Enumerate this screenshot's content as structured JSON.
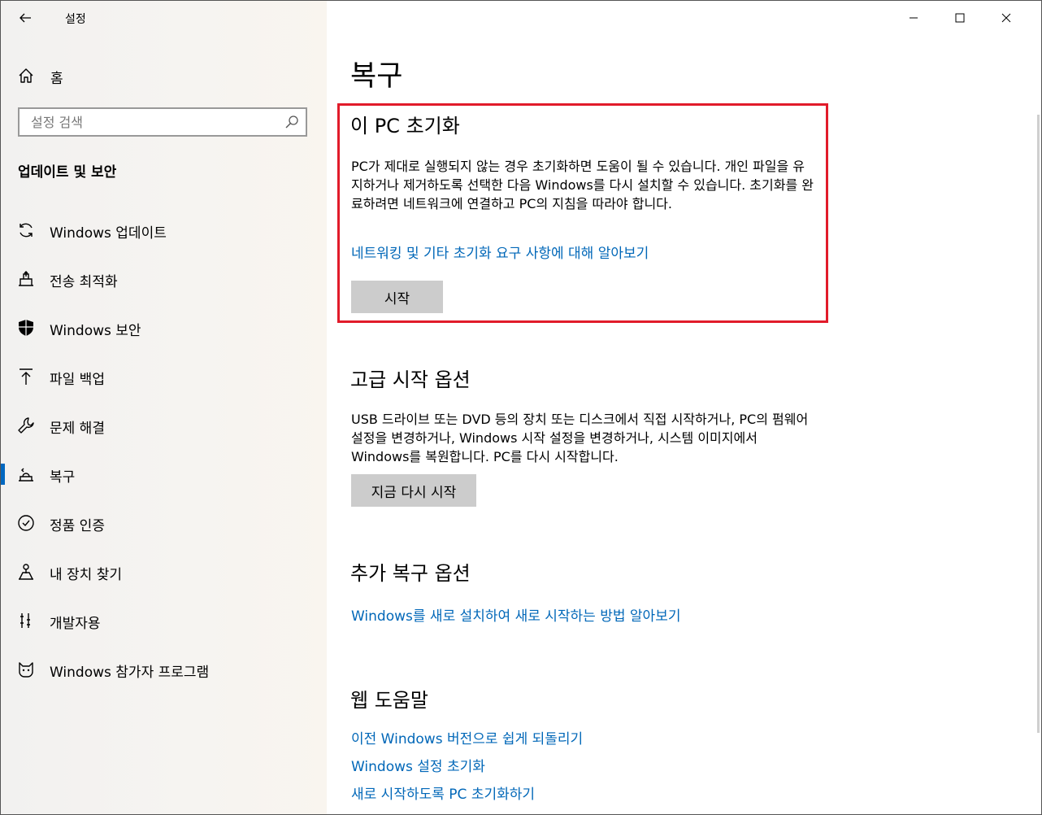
{
  "window": {
    "app_title": "설정"
  },
  "sidebar": {
    "home_label": "홈",
    "search_placeholder": "설정 검색",
    "section_title": "업데이트 및 보안",
    "items": [
      {
        "label": "Windows 업데이트",
        "icon": "sync-icon",
        "selected": false
      },
      {
        "label": "전송 최적화",
        "icon": "delivery-optimization-icon",
        "selected": false
      },
      {
        "label": "Windows 보안",
        "icon": "shield-icon",
        "selected": false
      },
      {
        "label": "파일 백업",
        "icon": "backup-arrow-icon",
        "selected": false
      },
      {
        "label": "문제 해결",
        "icon": "wrench-icon",
        "selected": false
      },
      {
        "label": "복구",
        "icon": "recovery-icon",
        "selected": true
      },
      {
        "label": "정품 인증",
        "icon": "check-circle-icon",
        "selected": false
      },
      {
        "label": "내 장치 찾기",
        "icon": "find-device-icon",
        "selected": false
      },
      {
        "label": "개발자용",
        "icon": "developer-icon",
        "selected": false
      },
      {
        "label": "Windows 참가자 프로그램",
        "icon": "insider-cat-icon",
        "selected": false
      }
    ]
  },
  "main": {
    "page_title": "복구",
    "reset_pc": {
      "title": "이 PC 초기화",
      "description": "PC가 제대로 실행되지 않는 경우 초기화하면 도움이 될 수 있습니다. 개인 파일을 유지하거나 제거하도록 선택한 다음 Windows를 다시 설치할 수 있습니다. 초기화를 완료하려면 네트워크에 연결하고 PC의 지침을 따라야 합니다.",
      "link": "네트워킹 및 기타 초기화 요구 사항에 대해 알아보기",
      "button": "시작"
    },
    "advanced_startup": {
      "title": "고급 시작 옵션",
      "description": "USB 드라이브 또는 DVD 등의 장치 또는 디스크에서 직접 시작하거나, PC의 펌웨어 설정을 변경하거나, Windows 시작 설정을 변경하거나, 시스템 이미지에서 Windows를 복원합니다. PC를 다시 시작합니다.",
      "button": "지금 다시 시작"
    },
    "more_recovery": {
      "title": "추가 복구 옵션",
      "link": "Windows를 새로 설치하여 새로 시작하는 방법 알아보기"
    },
    "web_help": {
      "title": "웹 도움말",
      "links": [
        "이전 Windows 버전으로 쉽게 되돌리기",
        "Windows 설정 초기화",
        "새로 시작하도록 PC 초기화하기"
      ]
    }
  },
  "colors": {
    "accent": "#0067b8",
    "highlight_border": "#e11b2a",
    "button_bg": "#cccccc"
  }
}
